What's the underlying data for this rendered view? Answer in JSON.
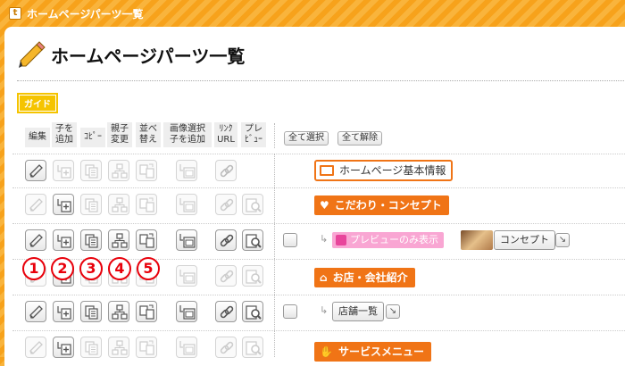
{
  "window": {
    "title": "ホームページパーツ一覧"
  },
  "page": {
    "title": "ホームページパーツ一覧",
    "guide_label": "ガイド"
  },
  "columns": {
    "edit": "編集",
    "add_child_1": "子を",
    "add_child_2": "追加",
    "copy": "ｺﾋﾟｰ",
    "parent_1": "親子",
    "parent_2": "変更",
    "sort_1": "並べ",
    "sort_2": "替え",
    "image_1": "画像選択",
    "image_2": "子を追加",
    "link_1": "ﾘﾝｸ",
    "link_2": "URL",
    "preview_1": "プレ",
    "preview_2": "ﾋﾞｭｰ"
  },
  "actions": {
    "select_all": "全て選択",
    "deselect_all": "全て解除"
  },
  "rows": {
    "r0": {
      "label": "ホームページ基本情報",
      "icon": "monitor-icon"
    },
    "r1": {
      "label": "こだわり・コンセプト",
      "icon": "heart-icon",
      "glyph": "♥"
    },
    "r2": {
      "badge": "プレビューのみ表示",
      "label": "コンセプト",
      "icon": "image-thumbnail"
    },
    "r3": {
      "label": "お店・会社紹介",
      "icon": "shop-icon",
      "glyph": "⌂"
    },
    "r4": {
      "label": "店舗一覧"
    },
    "r5": {
      "label": "サービスメニュー",
      "icon": "hand-icon",
      "glyph": "✋"
    }
  },
  "tree_glyph": "↳",
  "expand_glyph": "↘",
  "callouts": [
    "1",
    "2",
    "3",
    "4",
    "5"
  ],
  "colors": {
    "accent": "#f07416",
    "brand": "#f7a21b",
    "callout": "#e8000b",
    "badge": "#f9a6d3"
  }
}
